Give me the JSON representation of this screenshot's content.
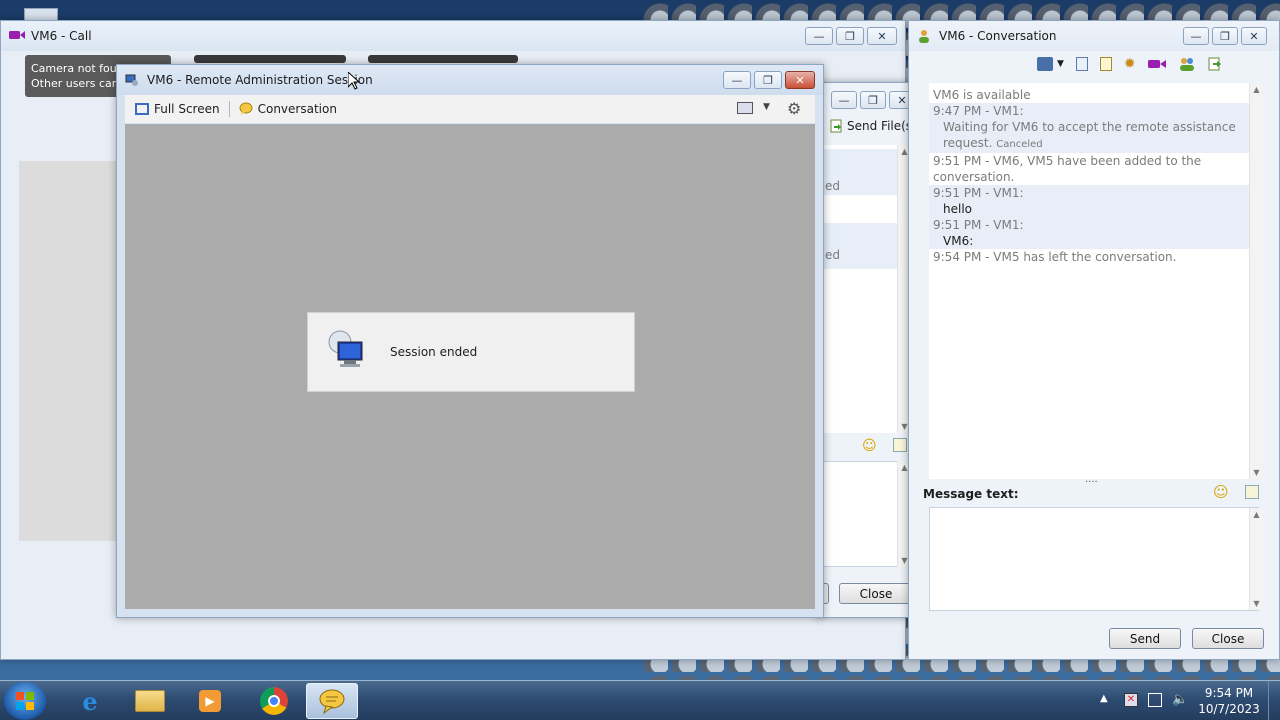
{
  "call_window": {
    "title": "VM6 - Call",
    "camera_notice_line1": "Camera not found",
    "camera_notice_line2": "Other users cannot"
  },
  "remote_session": {
    "title": "VM6 - Remote Administration Session",
    "full_screen_label": "Full Screen",
    "conversation_label": "Conversation",
    "session_status": "Session ended"
  },
  "middle_window": {
    "send_files_label": "Send File(s)",
    "partial_text_1": "ed",
    "partial_text_2": "ed",
    "close_label": "Close"
  },
  "conversation_window": {
    "title": "VM6 - Conversation",
    "messages": [
      {
        "text": "VM6 is available",
        "style": "gray"
      },
      {
        "text": "9:47 PM - VM1:",
        "style": "gray"
      },
      {
        "text": "Waiting for VM6 to accept the remote assistance",
        "style": "gray-indent"
      },
      {
        "text": "request.",
        "style": "gray-indent",
        "suffix": "Canceled"
      },
      {
        "text": "9:51 PM - VM6, VM5 have been added to the",
        "style": "gray"
      },
      {
        "text": "conversation.",
        "style": "gray"
      },
      {
        "text": "9:51 PM - VM1:",
        "style": "gray"
      },
      {
        "text": "hello",
        "style": "dark-indent"
      },
      {
        "text": "9:51 PM - VM1:",
        "style": "gray"
      },
      {
        "text": "VM6:",
        "style": "dark-indent"
      },
      {
        "text": "9:54 PM - VM5 has left the conversation.",
        "style": "gray"
      }
    ],
    "message_text_label": "Message text:",
    "send_label": "Send",
    "close_label": "Close"
  },
  "taskbar": {
    "time": "9:54 PM",
    "date": "10/7/2023"
  },
  "colors": {
    "accent_close": "#c8513a",
    "window_bg": "#eef3f9",
    "session_canvas": "#ababab"
  }
}
